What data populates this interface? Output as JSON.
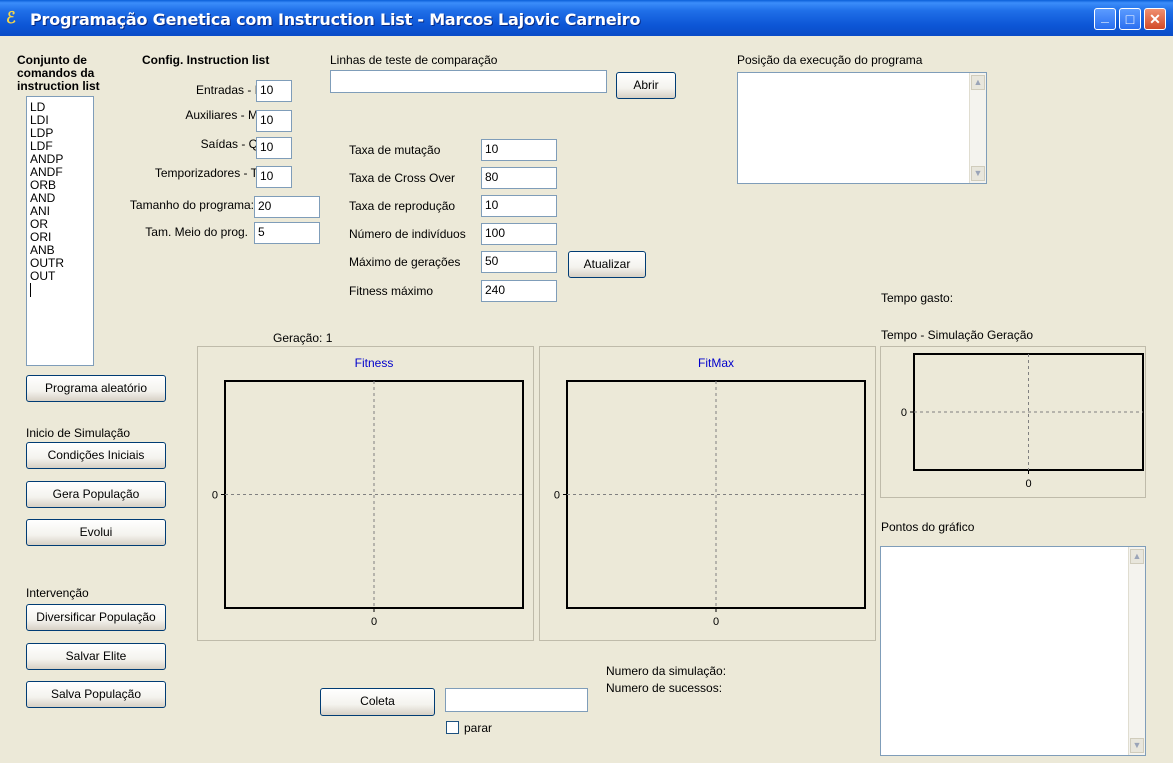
{
  "window": {
    "title": "Programação Genetica com Instruction List - Marcos Lajovic Carneiro",
    "min_glyph": "_",
    "max_glyph": "□",
    "close_glyph": "✕"
  },
  "command_set": {
    "title_line1": "Conjunto de",
    "title_line2": "comandos da",
    "title_line3": "instruction list",
    "items": [
      "LD",
      "LDI",
      "LDP",
      "LDF",
      "ANDP",
      "ANDF",
      "ORB",
      "AND",
      "ANI",
      "OR",
      "ORI",
      "ANB",
      "OUTR",
      "OUT"
    ]
  },
  "config": {
    "title": "Config. Instruction list",
    "fields": [
      {
        "label": "Entradas - I",
        "value": "10"
      },
      {
        "label": "Auxiliares - M",
        "value": "10"
      },
      {
        "label": "Saídas - Q",
        "value": "10"
      },
      {
        "label": "Temporizadores - T",
        "value": "10"
      },
      {
        "label": "Tamanho do programa:",
        "value": "20"
      },
      {
        "label": "Tam. Meio do prog.",
        "value": "5"
      }
    ]
  },
  "test_lines": {
    "label": "Linhas de teste de comparação",
    "value": "",
    "open_button": "Abrir"
  },
  "ga_params": {
    "fields": [
      {
        "label": "Taxa de mutação",
        "value": "10"
      },
      {
        "label": "Taxa de Cross Over",
        "value": "80"
      },
      {
        "label": "Taxa de reprodução",
        "value": "10"
      },
      {
        "label": "Número de indivíduos",
        "value": "100"
      },
      {
        "label": "Máximo de gerações",
        "value": "50"
      },
      {
        "label": "Fitness máximo",
        "value": "240"
      }
    ],
    "update_button": "Atualizar"
  },
  "exec_position": {
    "label": "Posição da execução do programa"
  },
  "time_spent": {
    "label": "Tempo gasto:"
  },
  "generation": {
    "label": "Geração: 1"
  },
  "buttons": {
    "random_program": "Programa aleatório",
    "sim_start_label": "Inicio de Simulação",
    "initial_conditions": "Condições Iniciais",
    "generate_population": "Gera População",
    "evolve": "Evolui",
    "intervention_label": "Intervenção",
    "diversify": "Diversificar População",
    "save_elite": "Salvar Elite",
    "save_population": "Salva População",
    "collect": "Coleta",
    "stop_label": "parar"
  },
  "status": {
    "sim_number": "Numero da simulação:",
    "successes": "Numero de sucessos:"
  },
  "points": {
    "label": "Pontos do gráfico"
  },
  "chart_data": [
    {
      "type": "line",
      "title": "Fitness",
      "series": [],
      "xticks": [
        "0"
      ],
      "yticks": [
        "0"
      ],
      "grid": "center-dashed",
      "title_color": "#0000cc"
    },
    {
      "type": "line",
      "title": "FitMax",
      "series": [],
      "xticks": [
        "0"
      ],
      "yticks": [
        "0"
      ],
      "grid": "center-dashed",
      "title_color": "#0000cc"
    },
    {
      "type": "line",
      "title": "Tempo - Simulação Geração",
      "series": [],
      "xticks": [
        "0"
      ],
      "yticks": [
        "0"
      ],
      "grid": "center-dashed"
    }
  ]
}
